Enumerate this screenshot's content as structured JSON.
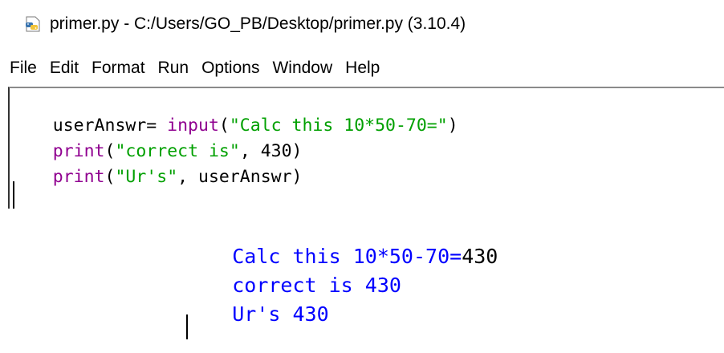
{
  "window": {
    "title": "primer.py - C:/Users/GO_PB/Desktop/primer.py (3.10.4)",
    "icon": "python-file-icon"
  },
  "menu": {
    "items": [
      "File",
      "Edit",
      "Format",
      "Run",
      "Options",
      "Window",
      "Help"
    ]
  },
  "editor": {
    "lines": [
      {
        "tokens": [
          {
            "text": "userAnswr= ",
            "kind": "default"
          },
          {
            "text": "input",
            "kind": "builtin"
          },
          {
            "text": "(",
            "kind": "default"
          },
          {
            "text": "\"Calc this 10*50-70=\"",
            "kind": "string"
          },
          {
            "text": ")",
            "kind": "default"
          }
        ]
      },
      {
        "tokens": [
          {
            "text": "print",
            "kind": "builtin"
          },
          {
            "text": "(",
            "kind": "default"
          },
          {
            "text": "\"correct is\"",
            "kind": "string"
          },
          {
            "text": ", 430)",
            "kind": "default"
          }
        ]
      },
      {
        "tokens": [
          {
            "text": "print",
            "kind": "builtin"
          },
          {
            "text": "(",
            "kind": "default"
          },
          {
            "text": "\"Ur's\"",
            "kind": "string"
          },
          {
            "text": ", userAnswr)",
            "kind": "default"
          }
        ]
      }
    ]
  },
  "shell": {
    "lines": [
      {
        "tokens": [
          {
            "text": "Calc this 10*50-70=",
            "kind": "stdout"
          },
          {
            "text": "430",
            "kind": "stdin"
          }
        ]
      },
      {
        "tokens": [
          {
            "text": "correct is 430",
            "kind": "stdout"
          }
        ]
      },
      {
        "tokens": [
          {
            "text": "Ur's 430",
            "kind": "stdout"
          }
        ]
      }
    ]
  },
  "colors": {
    "builtin": "#900090",
    "string": "#00a000",
    "stdout": "#0000ff",
    "stdin": "#000000"
  }
}
